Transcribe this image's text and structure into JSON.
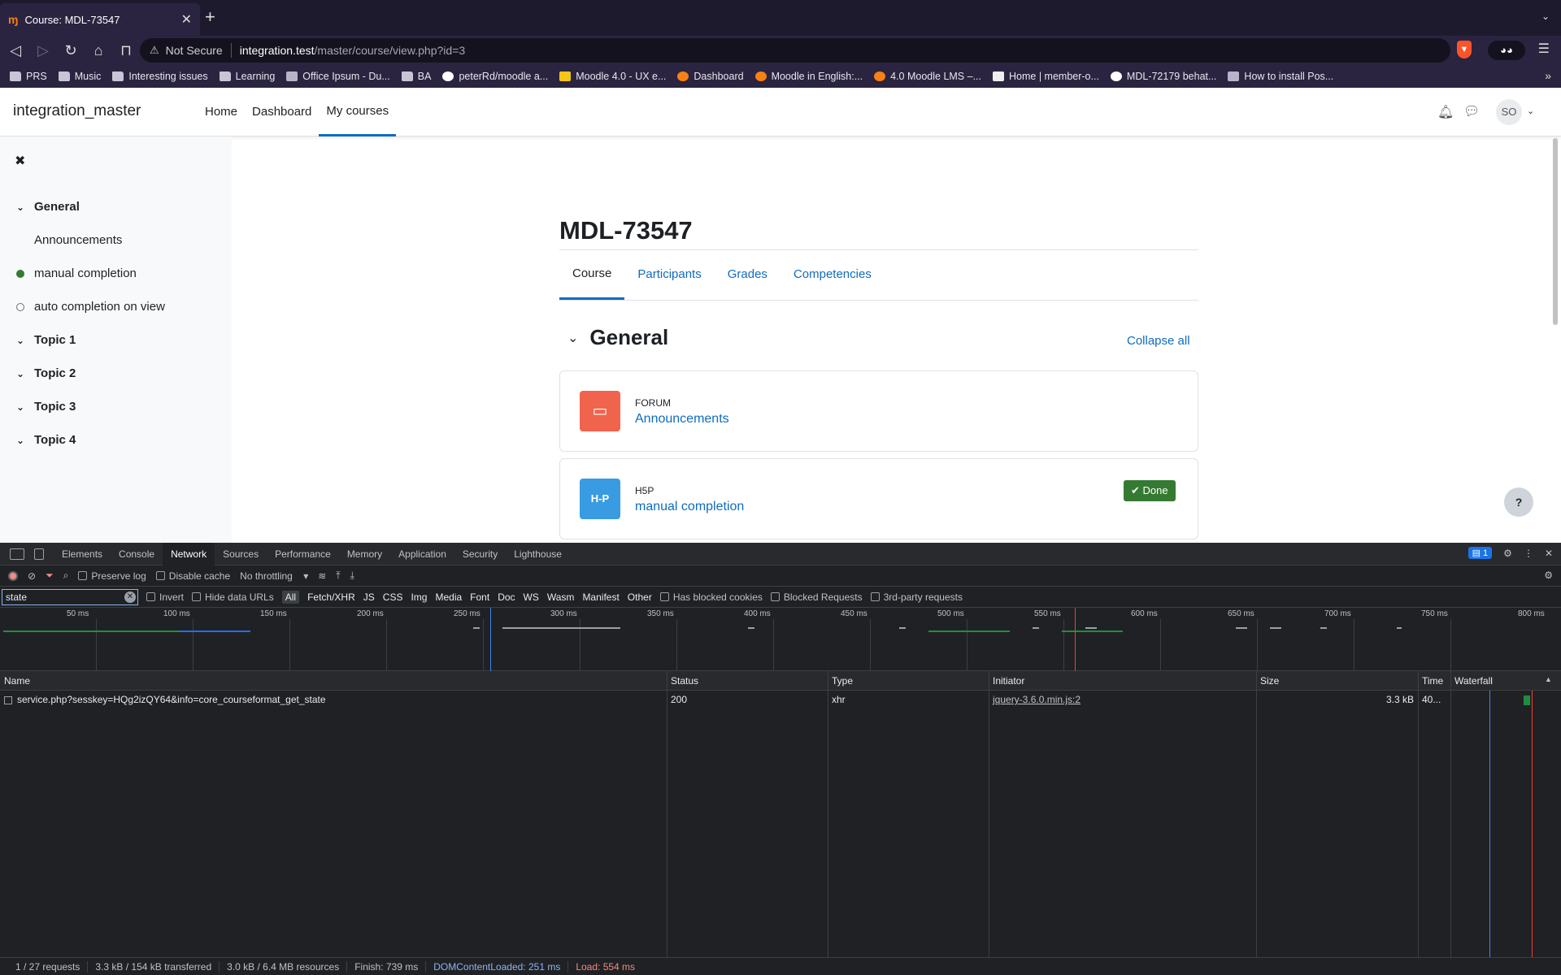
{
  "browser": {
    "tab_title": "Course: MDL-73547",
    "url_warning": "Not Secure",
    "url_host": "integration.test",
    "url_path": "/master/course/view.php?id=3",
    "bookmarks": [
      "PRS",
      "Music",
      "Interesting issues",
      "Learning",
      "Office Ipsum - Du...",
      "BA",
      "peterRd/moodle a...",
      "Moodle 4.0 - UX e...",
      "Dashboard",
      "Moodle in English:...",
      "4.0 Moodle LMS –...",
      "Home | member-o...",
      "MDL-72179 behat...",
      "How to install Pos..."
    ]
  },
  "moodle": {
    "site_name": "integration_master",
    "nav": [
      "Home",
      "Dashboard",
      "My courses"
    ],
    "avatar_initials": "SO",
    "course_index": {
      "general": "General",
      "announcements": "Announcements",
      "manual": "manual completion",
      "auto": "auto completion on view",
      "topic1": "Topic 1",
      "topic2": "Topic 2",
      "topic3": "Topic 3",
      "topic4": "Topic 4"
    },
    "course_title": "MDL-73547",
    "tabs": [
      "Course",
      "Participants",
      "Grades",
      "Competencies"
    ],
    "section_name": "General",
    "collapse_all": "Collapse all",
    "activities": [
      {
        "modname": "FORUM",
        "name": "Announcements",
        "icon": "forum-icon"
      },
      {
        "modname": "H5P",
        "name": "manual completion",
        "icon": "h5p-icon",
        "icon_text": "H-P",
        "completion": "Done"
      }
    ],
    "help": "?"
  },
  "devtools": {
    "tabs": [
      "Elements",
      "Console",
      "Network",
      "Sources",
      "Performance",
      "Memory",
      "Application",
      "Security",
      "Lighthouse"
    ],
    "issues_count": "1",
    "toolbar": {
      "preserve_log": "Preserve log",
      "disable_cache": "Disable cache",
      "throttling": "No throttling"
    },
    "filter": {
      "value": "state",
      "invert": "Invert",
      "hide_data_urls": "Hide data URLs",
      "types": [
        "All",
        "Fetch/XHR",
        "JS",
        "CSS",
        "Img",
        "Media",
        "Font",
        "Doc",
        "WS",
        "Wasm",
        "Manifest",
        "Other"
      ],
      "has_blocked_cookies": "Has blocked cookies",
      "blocked_requests": "Blocked Requests",
      "third_party": "3rd-party requests"
    },
    "timeline_ticks": [
      "50 ms",
      "100 ms",
      "150 ms",
      "200 ms",
      "250 ms",
      "300 ms",
      "350 ms",
      "400 ms",
      "450 ms",
      "500 ms",
      "550 ms",
      "600 ms",
      "650 ms",
      "700 ms",
      "750 ms",
      "800 ms"
    ],
    "columns": [
      "Name",
      "Status",
      "Type",
      "Initiator",
      "Size",
      "Time",
      "Waterfall"
    ],
    "rows": [
      {
        "name": "service.php?sesskey=HQg2izQY64&info=core_courseformat_get_state",
        "status": "200",
        "type": "xhr",
        "initiator": "jquery-3.6.0.min.js:2",
        "size": "3.3 kB",
        "time": "40..."
      }
    ],
    "status_bar": {
      "requests": "1 / 27 requests",
      "transferred": "3.3 kB / 154 kB transferred",
      "resources": "3.0 kB / 6.4 MB resources",
      "finish": "Finish: 739 ms",
      "dom": "DOMContentLoaded: 251 ms",
      "load": "Load: 554 ms"
    }
  }
}
